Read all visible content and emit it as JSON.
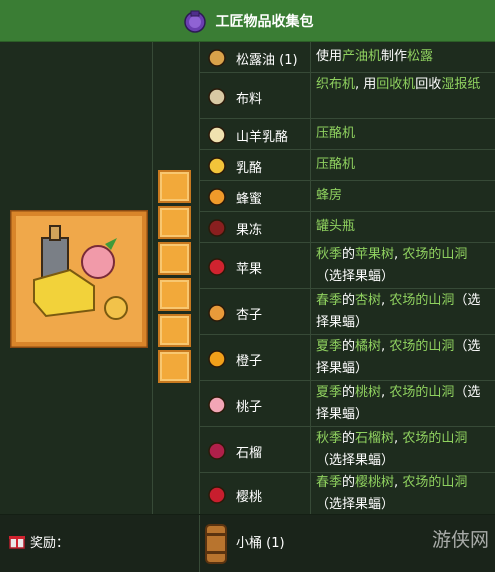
{
  "bundle": {
    "title": "工匠物品收集包"
  },
  "items": [
    {
      "name": "松露油",
      "count": "(1)",
      "source": [
        {
          "t": "使用",
          "h": false
        },
        {
          "t": "产油机",
          "h": true
        },
        {
          "t": "制作",
          "h": false
        },
        {
          "t": "松露",
          "h": true
        }
      ]
    },
    {
      "name": "布料",
      "count": "",
      "source": [
        {
          "t": "织布机",
          "h": true
        },
        {
          "t": ", 用",
          "h": false
        },
        {
          "t": "回收机",
          "h": true
        },
        {
          "t": "回收",
          "h": false
        },
        {
          "t": "湿报纸",
          "h": true
        }
      ]
    },
    {
      "name": "山羊乳酪",
      "count": "",
      "source": [
        {
          "t": "压酪机",
          "h": true
        }
      ]
    },
    {
      "name": "乳酪",
      "count": "",
      "source": [
        {
          "t": "压酪机",
          "h": true
        }
      ]
    },
    {
      "name": "蜂蜜",
      "count": "",
      "source": [
        {
          "t": "蜂房",
          "h": true
        }
      ]
    },
    {
      "name": "果冻",
      "count": "",
      "source": [
        {
          "t": "罐头瓶",
          "h": true
        }
      ]
    },
    {
      "name": "苹果",
      "count": "",
      "source": [
        {
          "t": "秋季",
          "h": true
        },
        {
          "t": "的",
          "h": false
        },
        {
          "t": "苹果树",
          "h": true
        },
        {
          "t": ", ",
          "h": false
        },
        {
          "t": "农场的山洞",
          "h": true
        },
        {
          "t": "（选择果蝠）",
          "h": false
        }
      ]
    },
    {
      "name": "杏子",
      "count": "",
      "source": [
        {
          "t": "春季",
          "h": true
        },
        {
          "t": "的",
          "h": false
        },
        {
          "t": "杏树",
          "h": true
        },
        {
          "t": ", ",
          "h": false
        },
        {
          "t": "农场的山洞",
          "h": true
        },
        {
          "t": "（选择果蝠）",
          "h": false
        }
      ]
    },
    {
      "name": "橙子",
      "count": "",
      "source": [
        {
          "t": "夏季",
          "h": true
        },
        {
          "t": "的",
          "h": false
        },
        {
          "t": "橘树",
          "h": true
        },
        {
          "t": ", ",
          "h": false
        },
        {
          "t": "农场的山洞",
          "h": true
        },
        {
          "t": "（选择果蝠）",
          "h": false
        }
      ]
    },
    {
      "name": "桃子",
      "count": "",
      "source": [
        {
          "t": "夏季",
          "h": true
        },
        {
          "t": "的",
          "h": false
        },
        {
          "t": "桃树",
          "h": true
        },
        {
          "t": ", ",
          "h": false
        },
        {
          "t": "农场的山洞",
          "h": true
        },
        {
          "t": "（选择果蝠）",
          "h": false
        }
      ]
    },
    {
      "name": "石榴",
      "count": "",
      "source": [
        {
          "t": "秋季",
          "h": true
        },
        {
          "t": "的",
          "h": false
        },
        {
          "t": "石榴树",
          "h": true
        },
        {
          "t": ", ",
          "h": false
        },
        {
          "t": "农场的山洞",
          "h": true
        },
        {
          "t": "（选择果蝠）",
          "h": false
        }
      ]
    },
    {
      "name": "樱桃",
      "count": "",
      "source": [
        {
          "t": "春季",
          "h": true
        },
        {
          "t": "的",
          "h": false
        },
        {
          "t": "樱桃树",
          "h": true
        },
        {
          "t": ", ",
          "h": false
        },
        {
          "t": "农场的山洞",
          "h": true
        },
        {
          "t": "（选择果蝠）",
          "h": false
        }
      ]
    }
  ],
  "icons": [
    "truffle-oil-icon",
    "cloth-icon",
    "goat-cheese-icon",
    "cheese-icon",
    "honey-icon",
    "jelly-icon",
    "apple-icon",
    "apricot-icon",
    "orange-icon",
    "peach-icon",
    "pomegranate-icon",
    "cherry-icon"
  ],
  "reward": {
    "label": "奖励：",
    "name": "小桶",
    "count": "(1)"
  },
  "watermark": "游侠网",
  "colors": {
    "header": "#3a7d34",
    "body": "#1e2c1e",
    "highlight": "#8fd15f",
    "slot": "#f2a93a"
  }
}
